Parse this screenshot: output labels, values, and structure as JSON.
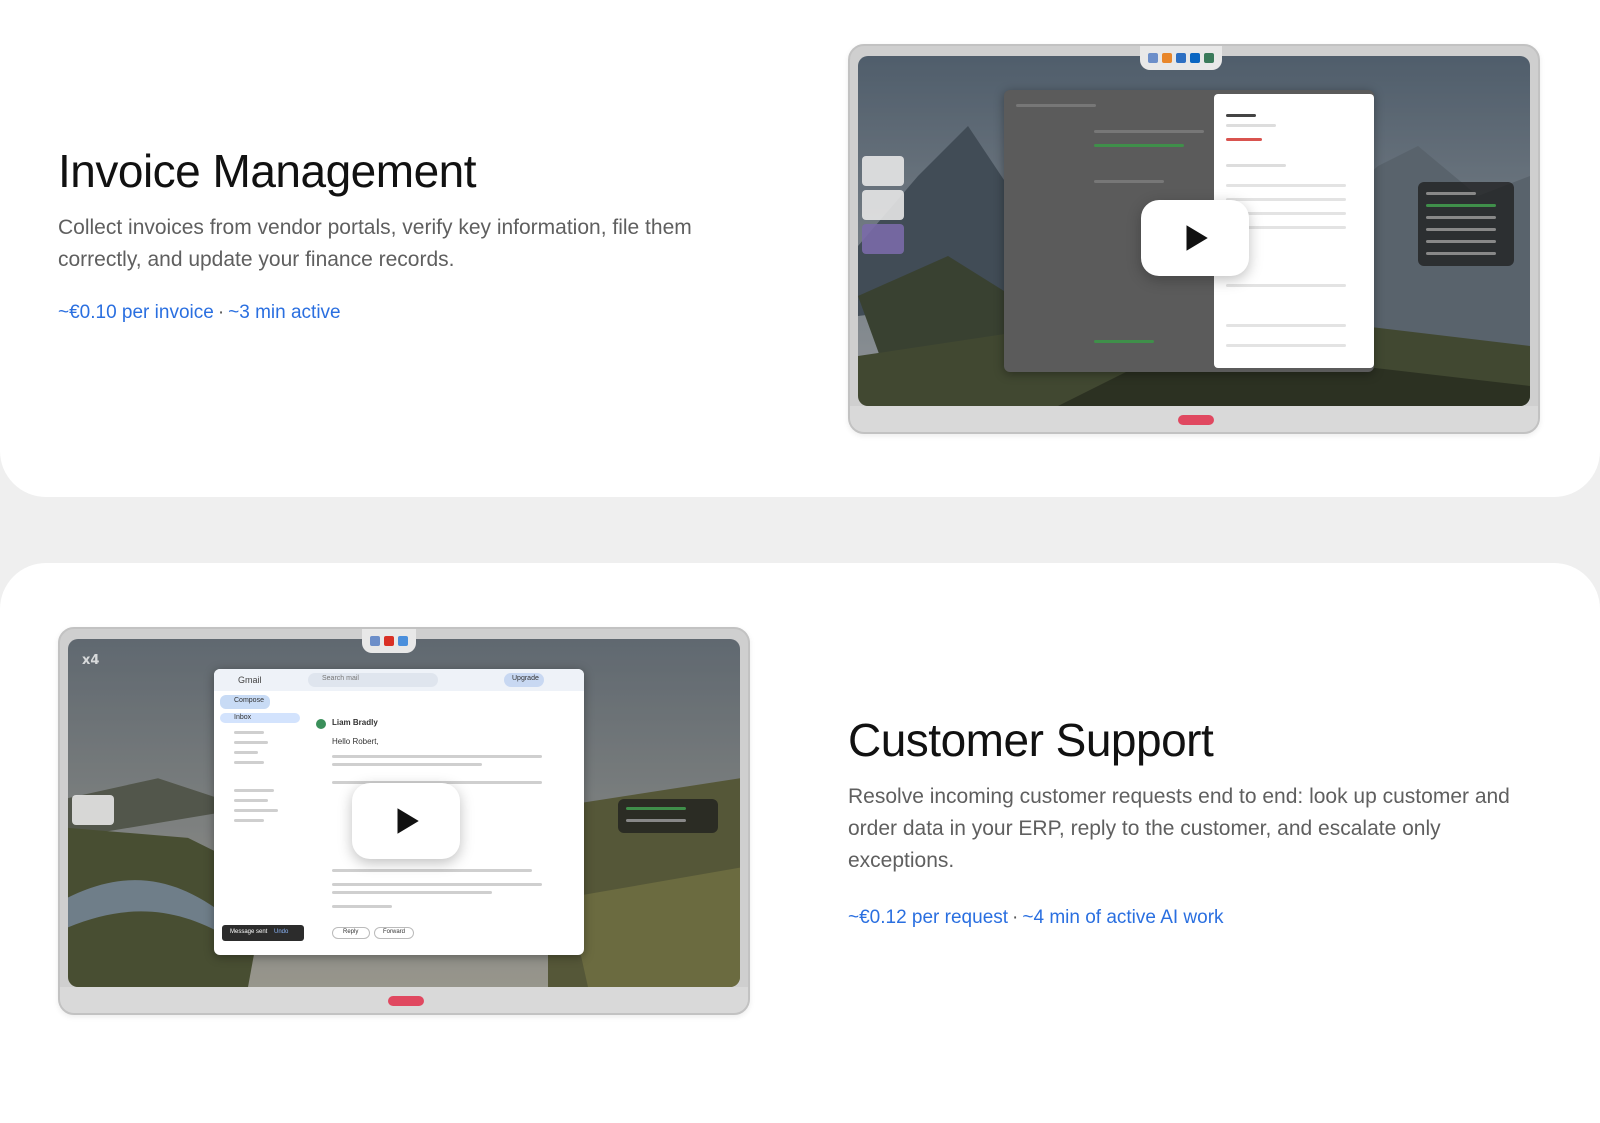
{
  "sections": [
    {
      "title": "Invoice Management",
      "description": "Collect invoices from vendor portals, verify key information, file them correctly, and update your finance records.",
      "metric_cost": "~€0.10 per invoice",
      "metric_time": "~3 min active",
      "separator": "·",
      "video": {
        "play_label": "Play video",
        "icon": "play-icon"
      }
    },
    {
      "title": "Customer Support",
      "description": "Resolve incoming customer requests end to end: look up customer and order data in your ERP, reply to the customer, and escalate only exceptions.",
      "metric_cost": "~€0.12 per request",
      "metric_time": "~4 min of active AI work",
      "separator": "·",
      "video": {
        "play_label": "Play video",
        "icon": "play-icon",
        "badge": "x4",
        "app_name": "Gmail",
        "compose": "Compose",
        "inbox": "Inbox",
        "search": "Search mail",
        "upgrade": "Upgrade",
        "sender": "Liam Bradly",
        "greeting": "Hello Robert,",
        "toast": "Message sent",
        "toast_action": "Undo",
        "reply": "Reply",
        "forward": "Forward"
      }
    }
  ],
  "colors": {
    "accent": "#2a6fe0",
    "record": "#e04860"
  }
}
